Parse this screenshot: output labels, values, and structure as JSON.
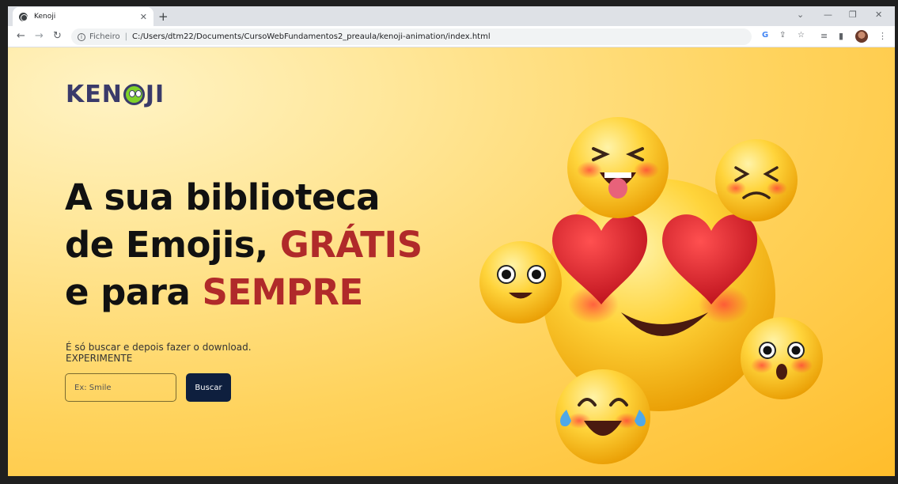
{
  "browser": {
    "tab_title": "Kenoji",
    "tab_close": "✕",
    "new_tab": "+",
    "address_scheme": "Ficheiro",
    "address_sep": "|",
    "address_path": "C:/Users/dtm22/Documents/CursoWebFundamentos2_preaula/kenoji-animation/index.html"
  },
  "page": {
    "logo_left": "KEN",
    "logo_right": "JI",
    "headline_line1": "A sua biblioteca",
    "headline_line2_a": "de Emojis, ",
    "headline_line2_b": "GRÁTIS",
    "headline_line3_a": "e para ",
    "headline_line3_b": "SEMPRE",
    "subtitle_line1": "É só buscar e depois fazer o download.",
    "subtitle_line2": "EXPERIMENTE",
    "search_placeholder": "Ex: Smile",
    "search_button": "Buscar"
  },
  "colors": {
    "accent": "#b02a2a",
    "button": "#0e1f3e",
    "logo": "#3a3a6a"
  }
}
